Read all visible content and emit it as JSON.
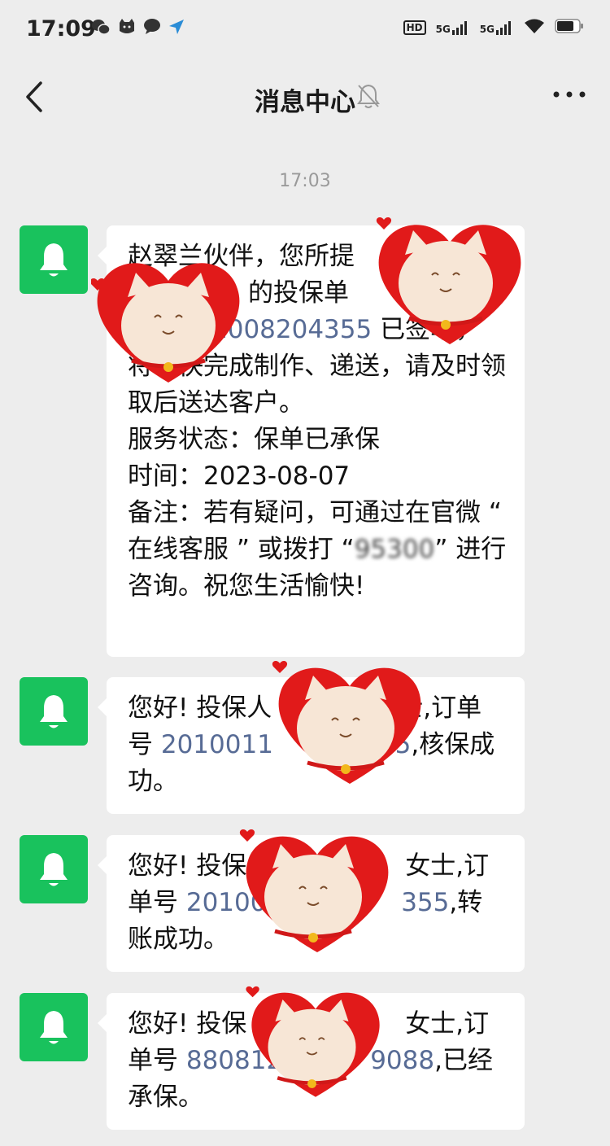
{
  "status_bar": {
    "time": "17:09",
    "left_icons": [
      "wechat-icon",
      "cat-app-icon",
      "chat-bubble-icon",
      "navigation-arrow-icon"
    ],
    "right_icons": [
      "hd-icon",
      "signal-5g-icon",
      "signal-5g-icon",
      "wifi-icon",
      "battery-icon"
    ],
    "hd_label": "HD",
    "net_label_1": "5G",
    "net_label_2": "5G"
  },
  "nav": {
    "title": "消息中心",
    "back_icon": "chevron-left-icon",
    "mute_icon": "bell-muted-icon",
    "more_icon": "more-dots-icon"
  },
  "timestamp": "17:03",
  "messages": [
    {
      "avatar_icon": "bell-icon",
      "segments": [
        {
          "text": "赵翠兰伙伴，您所提",
          "link": false
        },
        {
          "text": "的投保单",
          "link": false
        },
        {
          "text": "1008204355",
          "link": true
        },
        {
          "text": " 已签单，",
          "link": false
        },
        {
          "text": "将尽快完成制作、递送，请及时领取后送达客户。",
          "link": false
        },
        {
          "text": "服务状态：保单已承保",
          "link": false
        },
        {
          "text": "时间：2023-08-07",
          "link": false
        },
        {
          "text": "备注：若有疑问，可通过在官微 “ 在线客服 ” 或拨打 “",
          "link": false
        },
        {
          "text": "95300",
          "link": false
        },
        {
          "text": "” 进行咨询。祝您生活愉快!",
          "link": false
        }
      ]
    },
    {
      "avatar_icon": "bell-icon",
      "segments": [
        {
          "text": "您好! 投保人",
          "link": false
        },
        {
          "text": "士,订单号 ",
          "link": false
        },
        {
          "text": "2010011",
          "link": true
        },
        {
          "text": "55",
          "link": true
        },
        {
          "text": ",核保成功。",
          "link": false
        }
      ]
    },
    {
      "avatar_icon": "bell-icon",
      "segments": [
        {
          "text": "您好! 投保",
          "link": false
        },
        {
          "text": "女士,订单号 ",
          "link": false
        },
        {
          "text": "201003",
          "link": true
        },
        {
          "text": "355",
          "link": true
        },
        {
          "text": ",转账成功。",
          "link": false
        }
      ]
    },
    {
      "avatar_icon": "bell-icon",
      "segments": [
        {
          "text": "您好! 投保",
          "link": false
        },
        {
          "text": "女士,订单号 ",
          "link": false
        },
        {
          "text": "880812",
          "link": true
        },
        {
          "text": "9088",
          "link": true
        },
        {
          "text": ",已经承保。",
          "link": false
        }
      ]
    }
  ],
  "privacy_mask_icon": "cat-heart-sticker-icon"
}
